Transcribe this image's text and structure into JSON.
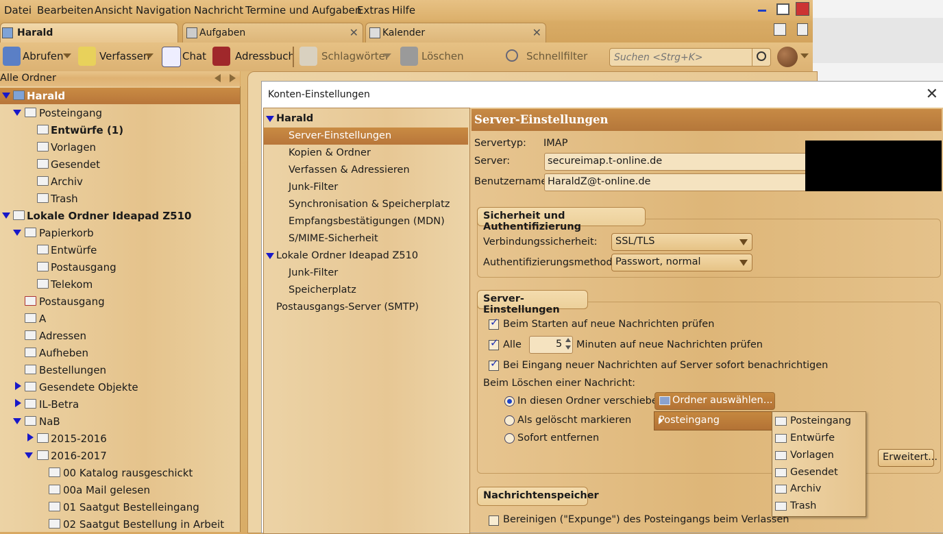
{
  "menubar": {
    "items": [
      "Datei",
      "Bearbeiten",
      "Ansicht",
      "Navigation",
      "Nachricht",
      "Termine und Aufgaben",
      "Extras",
      "Hilfe"
    ]
  },
  "tabs": [
    {
      "label": "Harald"
    },
    {
      "label": "Aufgaben"
    },
    {
      "label": "Kalender"
    }
  ],
  "toolbar": {
    "abrufen": "Abrufen",
    "verfassen": "Verfassen",
    "chat": "Chat",
    "adressbuch": "Adressbuch",
    "schlagwoerter": "Schlagwörter",
    "loeschen": "Löschen",
    "schnellfilter": "Schnellfilter",
    "search_placeholder": "Suchen <Strg+K>"
  },
  "folderpane": {
    "header": "Alle Ordner",
    "rows": [
      "Harald",
      "Posteingang",
      "Entwürfe (1)",
      "Vorlagen",
      "Gesendet",
      "Archiv",
      "Trash",
      "Lokale Ordner Ideapad Z510",
      "Papierkorb",
      "Entwürfe",
      "Postausgang",
      "Telekom",
      "Postausgang",
      "A",
      "Adressen",
      "Aufheben",
      "Bestellungen",
      "Gesendete Objekte",
      "IL-Betra",
      "NaB",
      "2015-2016",
      "2016-2017",
      "00 Katalog rausgeschickt",
      "00a Mail gelesen",
      "01 Saatgut Bestelleingang",
      "02 Saatgut Bestellung in Arbeit"
    ]
  },
  "dialog": {
    "title": "Konten-Einstellungen",
    "tree": [
      "Harald",
      "Server-Einstellungen",
      "Kopien & Ordner",
      "Verfassen & Adressieren",
      "Junk-Filter",
      "Synchronisation & Speicherplatz",
      "Empfangsbestätigungen (MDN)",
      "S/MIME-Sicherheit",
      "Lokale Ordner Ideapad Z510",
      "Junk-Filter",
      "Speicherplatz",
      "Postausgangs-Server (SMTP)"
    ],
    "panel": {
      "heading": "Server-Einstellungen",
      "servertyp_label": "Servertyp:",
      "servertyp_value": "IMAP",
      "server_label": "Server:",
      "server_value": "secureimap.t-online.de",
      "user_label": "Benutzername:",
      "user_value": "HaraldZ@t-online.de",
      "security_group": "Sicherheit und Authentifizierung",
      "conn_label": "Verbindungssicherheit:",
      "conn_value": "SSL/TLS",
      "auth_label": "Authentifizierungsmethode:",
      "auth_value": "Passwort, normal",
      "server_group": "Server-Einstellungen",
      "check_start": "Beim Starten auf neue Nachrichten prüfen",
      "check_every_label": "Alle",
      "check_every_value": "5",
      "check_every_suffix": "Minuten auf neue Nachrichten prüfen",
      "check_push": "Bei Eingang neuer Nachrichten auf Server sofort benachrichtigen",
      "delete_label": "Beim Löschen einer Nachricht:",
      "radio_move": "In diesen Ordner verschieben:",
      "folder_button": "Ordner auswählen...",
      "radio_mark": "Als gelöscht markieren",
      "radio_remove": "Sofort entfernen",
      "advanced_button": "Erweitert...",
      "store_group": "Nachrichtenspeicher",
      "expunge": "Bereinigen (\"Expunge\") des Posteingangs beim Verlassen"
    },
    "menu1": "Posteingang",
    "menu2": [
      "Posteingang",
      "Entwürfe",
      "Vorlagen",
      "Gesendet",
      "Archiv",
      "Trash"
    ]
  }
}
